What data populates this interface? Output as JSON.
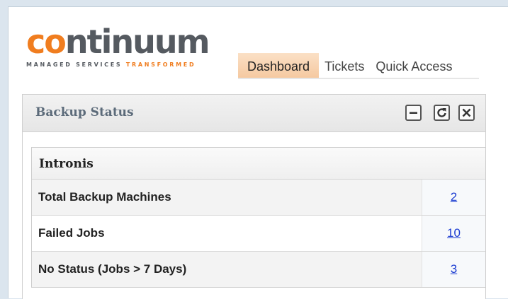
{
  "logo": {
    "word_part1": "co",
    "word_part2": "ntinuum",
    "tagline_part1": "MANAGED SERVICES ",
    "tagline_part2": "TRANSFORMED"
  },
  "tabs": [
    {
      "label": "Dashboard",
      "active": true
    },
    {
      "label": "Tickets",
      "active": false
    },
    {
      "label": "Quick Access",
      "active": false
    }
  ],
  "widget": {
    "title": "Backup Status",
    "controls": [
      "minimize-icon",
      "refresh-icon",
      "close-icon"
    ],
    "section": {
      "title": "Intronis",
      "rows": [
        {
          "label": "Total Backup Machines",
          "value": "2"
        },
        {
          "label": "Failed Jobs",
          "value": "10"
        },
        {
          "label": "No Status (Jobs > 7 Days)",
          "value": "3"
        }
      ]
    }
  },
  "colors": {
    "brand_orange": "#f07d1f",
    "brand_gray": "#555a60",
    "link_blue": "#1a3bd1",
    "active_tab": "#f5c9a0"
  }
}
